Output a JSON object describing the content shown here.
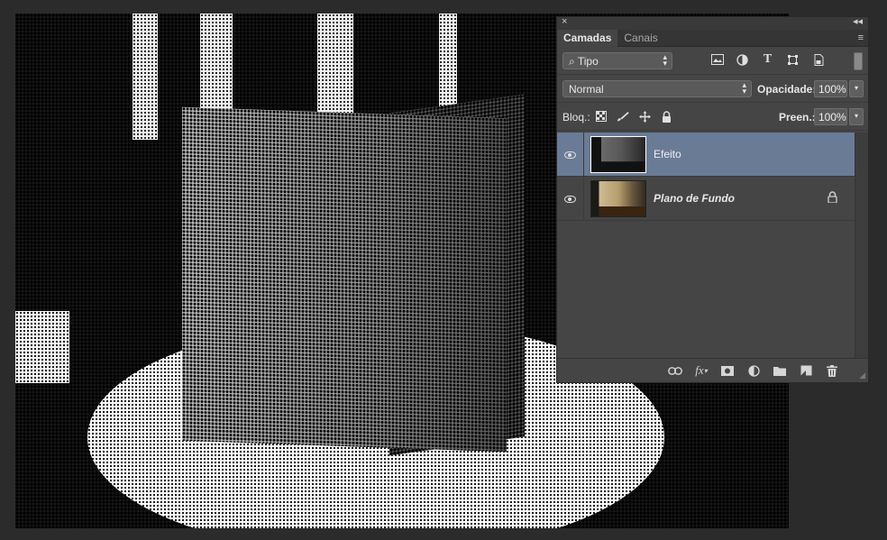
{
  "panel": {
    "close_glyph": "×",
    "collapse_glyph": "◂◂",
    "tabs": [
      {
        "label": "Camadas",
        "active": true
      },
      {
        "label": "Canais",
        "active": false
      }
    ],
    "menu_glyph": "≡",
    "filter": {
      "label": "Tipo",
      "icons": [
        "image-filter-icon",
        "adjustment-filter-icon",
        "type-filter-icon",
        "shape-filter-icon",
        "smart-object-filter-icon"
      ]
    },
    "blend": {
      "mode": "Normal",
      "opacity_label": "Opacidade:",
      "opacity_value": "100%"
    },
    "lock": {
      "label": "Bloq.:",
      "icons": [
        "lock-transparent-icon",
        "lock-image-icon",
        "lock-position-icon",
        "lock-all-icon"
      ],
      "fill_label": "Preen.:",
      "fill_value": "100%"
    },
    "layers": [
      {
        "name": "Efeito",
        "visible": true,
        "selected": true,
        "locked": false
      },
      {
        "name": "Plano de Fundo",
        "visible": true,
        "selected": false,
        "locked": true
      }
    ],
    "bottom_icons": [
      "link-layers-icon",
      "layer-style-fx-icon",
      "add-mask-icon",
      "adjustment-layer-icon",
      "new-group-icon",
      "new-layer-icon",
      "delete-layer-icon"
    ],
    "colors": {
      "panel_bg": "#454545",
      "selected_layer": "#6a7b96",
      "app_bg": "#2b2b2b"
    }
  }
}
